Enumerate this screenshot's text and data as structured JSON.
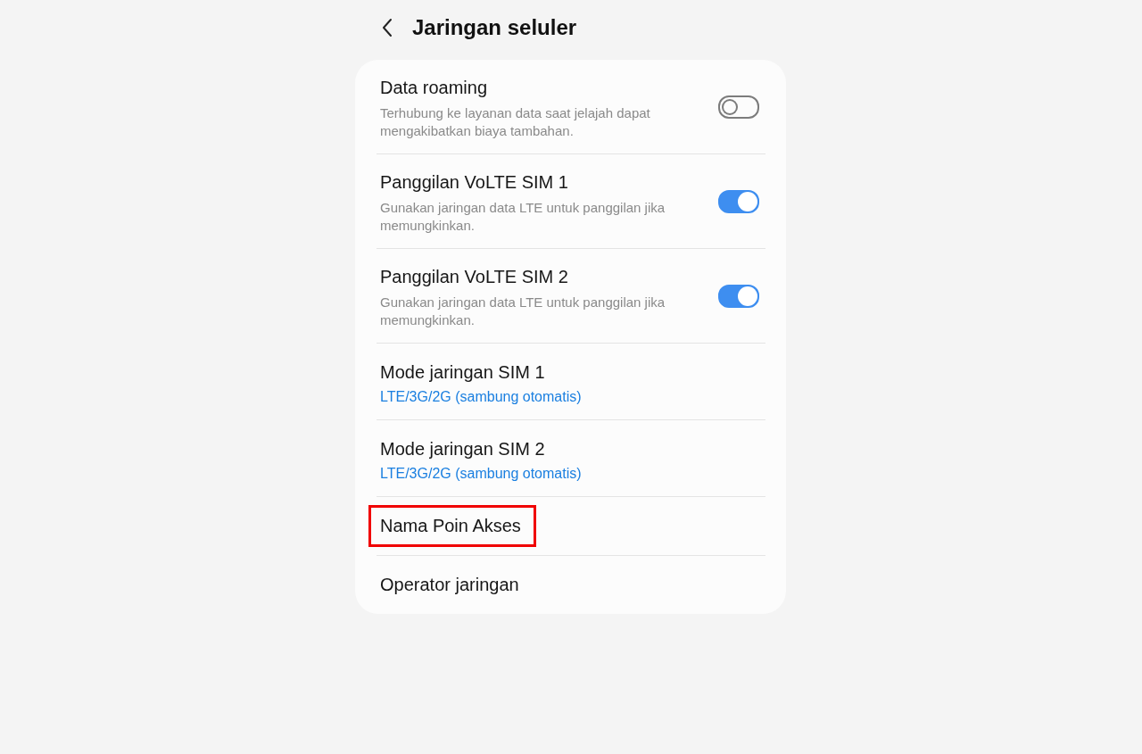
{
  "header": {
    "title": "Jaringan seluler"
  },
  "items": [
    {
      "kind": "toggle",
      "title": "Data roaming",
      "subtitle": "Terhubung ke layanan data saat jelajah dapat mengakibatkan biaya tambahan.",
      "on": false
    },
    {
      "kind": "toggle",
      "title": "Panggilan VoLTE SIM 1",
      "subtitle": "Gunakan jaringan data LTE untuk panggilan jika memungkinkan.",
      "on": true
    },
    {
      "kind": "toggle",
      "title": "Panggilan VoLTE SIM 2",
      "subtitle": "Gunakan jaringan data LTE untuk panggilan jika memungkinkan.",
      "on": true
    },
    {
      "kind": "value",
      "title": "Mode jaringan SIM 1",
      "value": "LTE/3G/2G (sambung otomatis)"
    },
    {
      "kind": "value",
      "title": "Mode jaringan SIM 2",
      "value": "LTE/3G/2G (sambung otomatis)"
    },
    {
      "kind": "plain",
      "title": "Nama Poin Akses",
      "highlighted": true
    },
    {
      "kind": "plain",
      "title": "Operator jaringan",
      "highlighted": false
    }
  ]
}
